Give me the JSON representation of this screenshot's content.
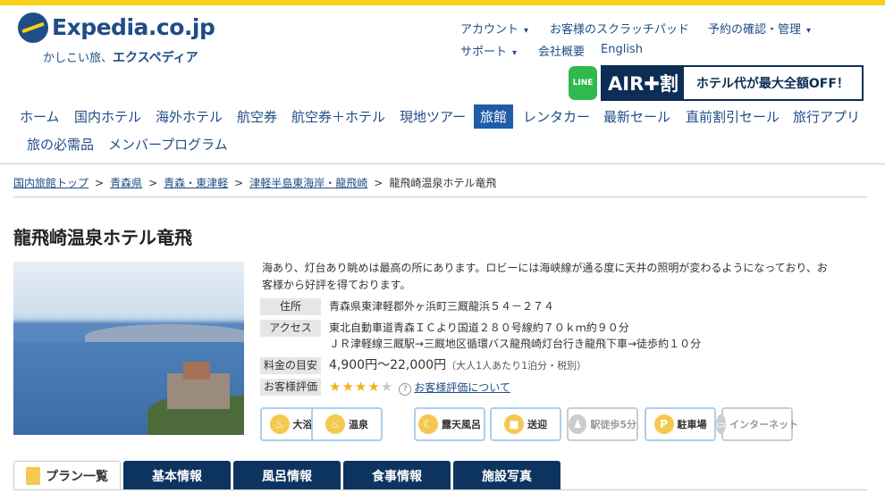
{
  "header": {
    "brand": "Expedia.co.jp",
    "tagline_prefix": "かしこい旅、",
    "tagline_bold": "エクスペディア",
    "util_links": [
      "アカウント",
      "お客様のスクラッチパッド",
      "予約の確認・管理",
      "サポート",
      "会社概要",
      "English"
    ],
    "banner": {
      "line_badge": "LINE",
      "air": "AIR✚割",
      "message": "ホテル代が最大全額OFF！"
    }
  },
  "nav": {
    "items": [
      "ホーム",
      "国内ホテル",
      "海外ホテル",
      "航空券",
      "航空券＋ホテル",
      "現地ツアー",
      "旅館",
      "レンタカー",
      "最新セール",
      "直前割引セール",
      "旅行アプリ",
      "旅の必需品",
      "メンバープログラム"
    ],
    "active": "旅館"
  },
  "breadcrumb": [
    "国内旅館トップ",
    "青森県",
    "青森・東津軽",
    "津軽半島東海岸・龍飛崎",
    "龍飛崎温泉ホテル竜飛"
  ],
  "hotel": {
    "name": "龍飛崎温泉ホテル竜飛",
    "description": "海あり、灯台あり眺めは最高の所にあります。ロビーには海峡線が通る度に天井の照明が変わるようになっており、お客様から好評を得ております。",
    "address_label": "住所",
    "address": "青森県東津軽郡外ヶ浜町三厩龍浜５４－２７４",
    "access_label": "アクセス",
    "access_1": "東北自動車道青森ＩＣより国道２８０号線約７０ｋｍ約９０分",
    "access_2": "ＪＲ津軽線三厩駅→三厩地区循環バス龍飛崎灯台行き龍飛下車→徒歩約１０分",
    "price_label": "料金の目安",
    "price": "4,900円〜22,000円",
    "price_note": "（大人1人あたり1泊分・税別）",
    "rating_label": "お客様評価",
    "rating": 4,
    "rating_max": 5,
    "rating_link": "お客様評価について"
  },
  "amenities": [
    {
      "icon": "large-bath-icon",
      "label": "大浴場",
      "enabled": true
    },
    {
      "icon": "hot-spring-icon",
      "label": "温泉",
      "enabled": true
    },
    {
      "icon": "open-air-bath-icon",
      "label": "露天風呂",
      "enabled": true
    },
    {
      "icon": "shuttle-bus-icon",
      "label": "送迎",
      "enabled": true
    },
    {
      "icon": "walking-icon",
      "label": "駅徒歩5分",
      "enabled": false
    },
    {
      "icon": "parking-icon",
      "label": "駐車場",
      "enabled": true
    },
    {
      "icon": "internet-icon",
      "label": "インターネット",
      "enabled": false
    }
  ],
  "tabs": [
    "プラン一覧",
    "基本情報",
    "風呂情報",
    "食事情報",
    "施設写真"
  ],
  "colors": {
    "brand_blue": "#1f4d87",
    "accent_yellow": "#f7d117",
    "tab_navy": "#0d3460"
  }
}
